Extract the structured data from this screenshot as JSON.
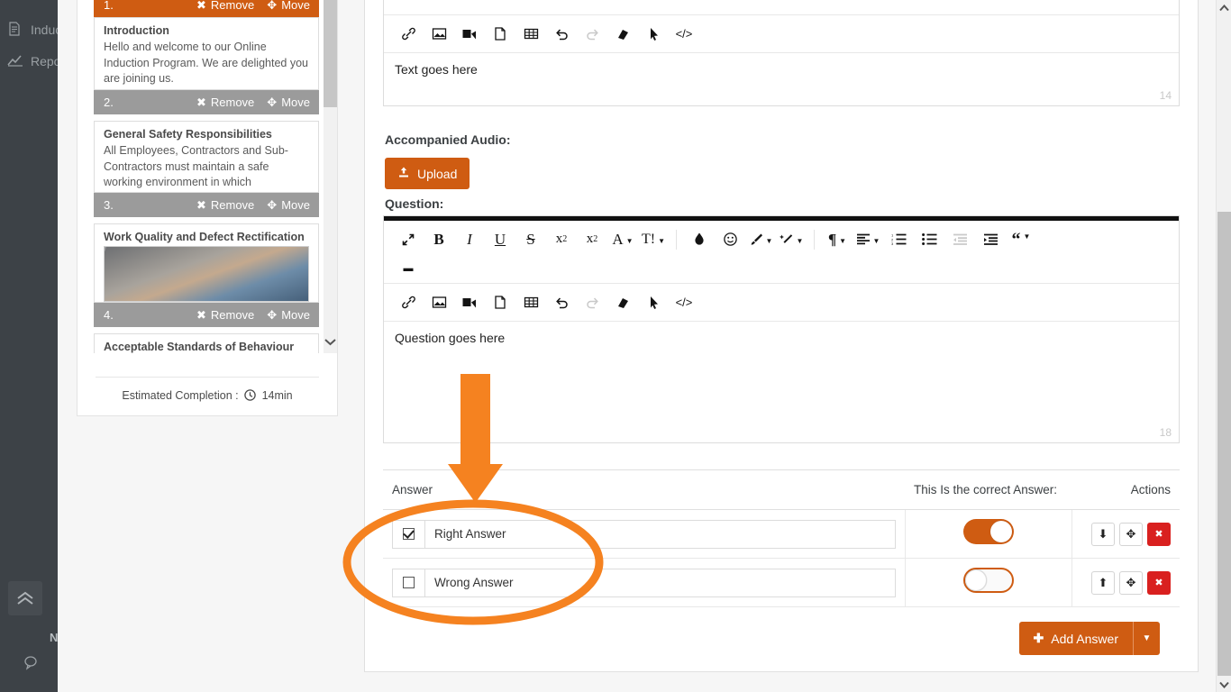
{
  "left_nav": {
    "items": [
      {
        "label": "Induction",
        "icon": "document-icon"
      },
      {
        "label": "Reports",
        "icon": "chart-line-icon"
      }
    ],
    "collapse_icon": "double-chevron-up-icon",
    "footer_label": "N",
    "footer_icons": [
      "chat-bubble-icon",
      "circle-icon"
    ]
  },
  "module_list": {
    "items": [
      {
        "number": "1.",
        "remove_label": "Remove",
        "move_label": "Move",
        "state": "active",
        "title": "",
        "text": "",
        "has_image": false
      },
      {
        "number": "2.",
        "remove_label": "Remove",
        "move_label": "Move",
        "state": "inactive",
        "title": "Introduction",
        "text": "Hello and welcome to our Online Induction Program. We are delighted you are joining us.",
        "has_image": false
      },
      {
        "number": "3.",
        "remove_label": "Remove",
        "move_label": "Move",
        "state": "inactive",
        "title": "General Safety Responsibilities",
        "text": "All Employees, Contractors and Sub-Contractors must maintain a safe working environment in which",
        "has_image": false
      },
      {
        "number": "4.",
        "remove_label": "Remove",
        "move_label": "Move",
        "state": "inactive",
        "title": "Work Quality and Defect Rectification",
        "text": "",
        "has_image": true
      },
      {
        "number": "",
        "remove_label": "",
        "move_label": "",
        "state": "partial",
        "title": "Acceptable Standards of Behaviour",
        "text": "",
        "has_image": false
      }
    ],
    "estimated_label": "Estimated Completion :",
    "estimated_value": "14min",
    "clock_icon": "clock-icon"
  },
  "editors": {
    "text_editor": {
      "content": "Text goes here",
      "char_count": "14"
    },
    "question_editor": {
      "content": "Question goes here",
      "char_count": "18"
    },
    "toolbar_row1": [
      {
        "name": "fullscreen-icon",
        "glyph": "⤡"
      },
      {
        "name": "bold-icon",
        "glyph": "B"
      },
      {
        "name": "italic-icon",
        "glyph": "I"
      },
      {
        "name": "underline-icon",
        "glyph": "U"
      },
      {
        "name": "strikethrough-icon",
        "glyph": "S"
      },
      {
        "name": "subscript-icon",
        "glyph": "x₂"
      },
      {
        "name": "superscript-icon",
        "glyph": "x²"
      },
      {
        "name": "font-family-icon",
        "glyph": "A"
      },
      {
        "name": "font-size-icon",
        "glyph": "T!"
      },
      {
        "name": "text-color-icon",
        "glyph": "◆"
      },
      {
        "name": "emoticon-icon",
        "glyph": "☺"
      },
      {
        "name": "paint-brush-icon",
        "glyph": "✒"
      },
      {
        "name": "magic-wand-icon",
        "glyph": "✦"
      },
      {
        "name": "paragraph-format-icon",
        "glyph": "¶"
      },
      {
        "name": "align-icon",
        "glyph": "≡"
      },
      {
        "name": "ordered-list-icon",
        "glyph": "☰"
      },
      {
        "name": "unordered-list-icon",
        "glyph": "☰"
      },
      {
        "name": "outdent-icon",
        "glyph": "⇤"
      },
      {
        "name": "indent-icon",
        "glyph": "⇥"
      },
      {
        "name": "quote-icon",
        "glyph": "“"
      },
      {
        "name": "horizontal-rule-icon",
        "glyph": "▬"
      }
    ],
    "toolbar_row2": [
      {
        "name": "insert-link-icon",
        "glyph": "🔗"
      },
      {
        "name": "insert-image-icon",
        "glyph": "Ὓc"
      },
      {
        "name": "insert-video-icon",
        "glyph": "▶"
      },
      {
        "name": "insert-file-icon",
        "glyph": "὜b"
      },
      {
        "name": "insert-table-icon",
        "glyph": "⊞"
      },
      {
        "name": "undo-icon",
        "glyph": "↺"
      },
      {
        "name": "redo-icon",
        "glyph": "↻"
      },
      {
        "name": "clear-formatting-icon",
        "glyph": "▱"
      },
      {
        "name": "select-all-icon",
        "glyph": "➤"
      },
      {
        "name": "code-view-icon",
        "glyph": "</>"
      }
    ]
  },
  "main": {
    "audio_label": "Accompanied Audio:",
    "upload_label": "Upload",
    "upload_icon": "upload-icon",
    "question_label": "Question:"
  },
  "answers_table": {
    "columns": [
      "Answer",
      "This Is the correct Answer:",
      "Actions"
    ],
    "rows": [
      {
        "checked": true,
        "text": "Right Answer",
        "correct": true,
        "actions": [
          "arrow-down-icon",
          "move-icon",
          "delete-icon"
        ]
      },
      {
        "checked": false,
        "text": "Wrong Answer",
        "correct": false,
        "actions": [
          "arrow-up-icon",
          "move-icon",
          "delete-icon"
        ]
      }
    ],
    "add_label": "Add Answer",
    "add_icon": "plus-icon",
    "add_caret_icon": "caret-down-icon"
  },
  "colors": {
    "accent": "#cf5c12",
    "annotation": "#f58220",
    "danger": "#d9201f",
    "nav_bg": "#3d4247"
  }
}
